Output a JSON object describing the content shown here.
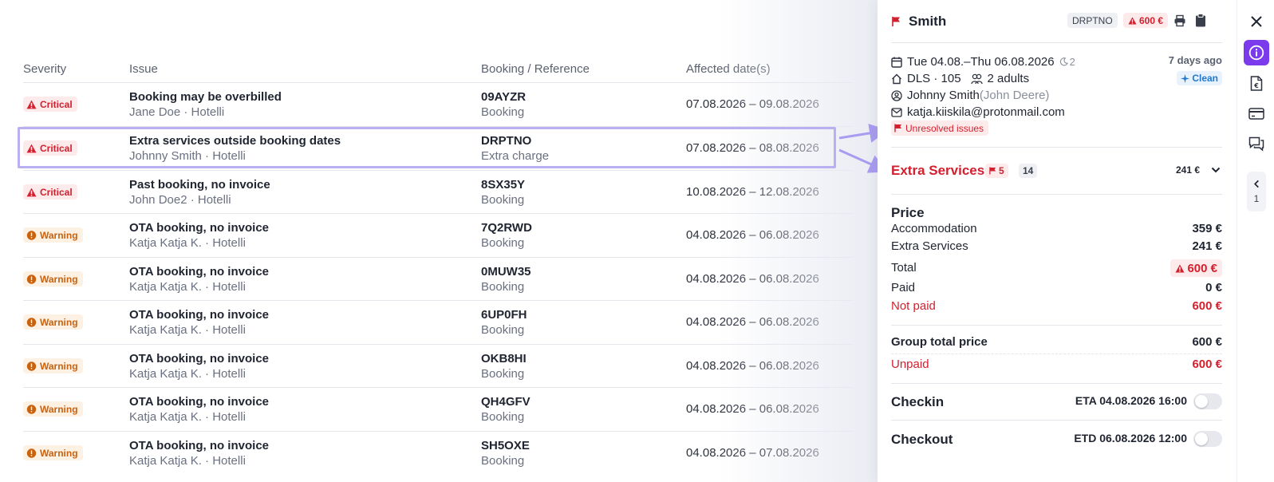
{
  "table": {
    "headers": {
      "severity": "Severity",
      "issue": "Issue",
      "reference": "Booking / Reference",
      "dates": "Affected date(s)"
    },
    "rows": [
      {
        "severity": "Critical",
        "level": "critical",
        "title": "Booking may be overbilled",
        "subtitle": "Jane Doe · Hotelli",
        "ref": "09AYZR",
        "ref_type": "Booking",
        "dates": "07.08.2026 – 09.08.2026"
      },
      {
        "severity": "Critical",
        "level": "critical",
        "title": "Extra services outside booking dates",
        "subtitle": "Johnny Smith · Hotelli",
        "ref": "DRPTNO",
        "ref_type": "Extra charge",
        "dates": "07.08.2026 – 08.08.2026"
      },
      {
        "severity": "Critical",
        "level": "critical",
        "title": "Past booking, no invoice",
        "subtitle": "John Doe2 · Hotelli",
        "ref": "8SX35Y",
        "ref_type": "Booking",
        "dates": "10.08.2026 – 12.08.2026"
      },
      {
        "severity": "Warning",
        "level": "warning",
        "title": "OTA booking, no invoice",
        "subtitle": "Katja Katja K. · Hotelli",
        "ref": "7Q2RWD",
        "ref_type": "Booking",
        "dates": "04.08.2026 – 06.08.2026"
      },
      {
        "severity": "Warning",
        "level": "warning",
        "title": "OTA booking, no invoice",
        "subtitle": "Katja Katja K. · Hotelli",
        "ref": "0MUW35",
        "ref_type": "Booking",
        "dates": "04.08.2026 – 06.08.2026"
      },
      {
        "severity": "Warning",
        "level": "warning",
        "title": "OTA booking, no invoice",
        "subtitle": "Katja Katja K. · Hotelli",
        "ref": "6UP0FH",
        "ref_type": "Booking",
        "dates": "04.08.2026 – 06.08.2026"
      },
      {
        "severity": "Warning",
        "level": "warning",
        "title": "OTA booking, no invoice",
        "subtitle": "Katja Katja K. · Hotelli",
        "ref": "OKB8HI",
        "ref_type": "Booking",
        "dates": "04.08.2026 – 06.08.2026"
      },
      {
        "severity": "Warning",
        "level": "warning",
        "title": "OTA booking, no invoice",
        "subtitle": "Katja Katja K. · Hotelli",
        "ref": "QH4GFV",
        "ref_type": "Booking",
        "dates": "04.08.2026 – 06.08.2026"
      },
      {
        "severity": "Warning",
        "level": "warning",
        "title": "OTA booking, no invoice",
        "subtitle": "Katja Katja K. · Hotelli",
        "ref": "SH5OXE",
        "ref_type": "Booking",
        "dates": "04.08.2026 – 07.08.2026"
      }
    ]
  },
  "panel": {
    "guest_name": "Smith",
    "booking_code": "DRPTNO",
    "alert_amount": "600 €",
    "stay_dates": "Tue 04.08.–Thu 06.08.2026",
    "nights": "2",
    "created_ago": "7 days ago",
    "room": "DLS · 105",
    "guests": "2 adults",
    "clean_status": "Clean",
    "contact_name": "Johnny Smith",
    "contact_alias": "(John Deere)",
    "email": "katja.kiiskila@protonmail.com",
    "unresolved": "Unresolved issues",
    "extra_services": {
      "title": "Extra Services",
      "flag_count": "5",
      "item_count": "14",
      "total": "241 €"
    },
    "price": {
      "title": "Price",
      "accommodation_label": "Accommodation",
      "accommodation": "359 €",
      "extras_label": "Extra Services",
      "extras": "241 €",
      "total_label": "Total",
      "total": "600 €",
      "paid_label": "Paid",
      "paid": "0 €",
      "not_paid_label": "Not paid",
      "not_paid": "600 €"
    },
    "group": {
      "total_label": "Group total price",
      "total": "600 €",
      "unpaid_label": "Unpaid",
      "unpaid": "600 €"
    },
    "checkin": {
      "label": "Checkin",
      "eta": "ETA 04.08.2026 16:00"
    },
    "checkout": {
      "label": "Checkout",
      "etd": "ETD 06.08.2026 12:00"
    }
  },
  "rail": {
    "count": "1"
  },
  "colors": {
    "critical": "#d2202f",
    "warning": "#c9620f",
    "accent": "#7c3aed",
    "highlight": "#b8b0f0"
  }
}
